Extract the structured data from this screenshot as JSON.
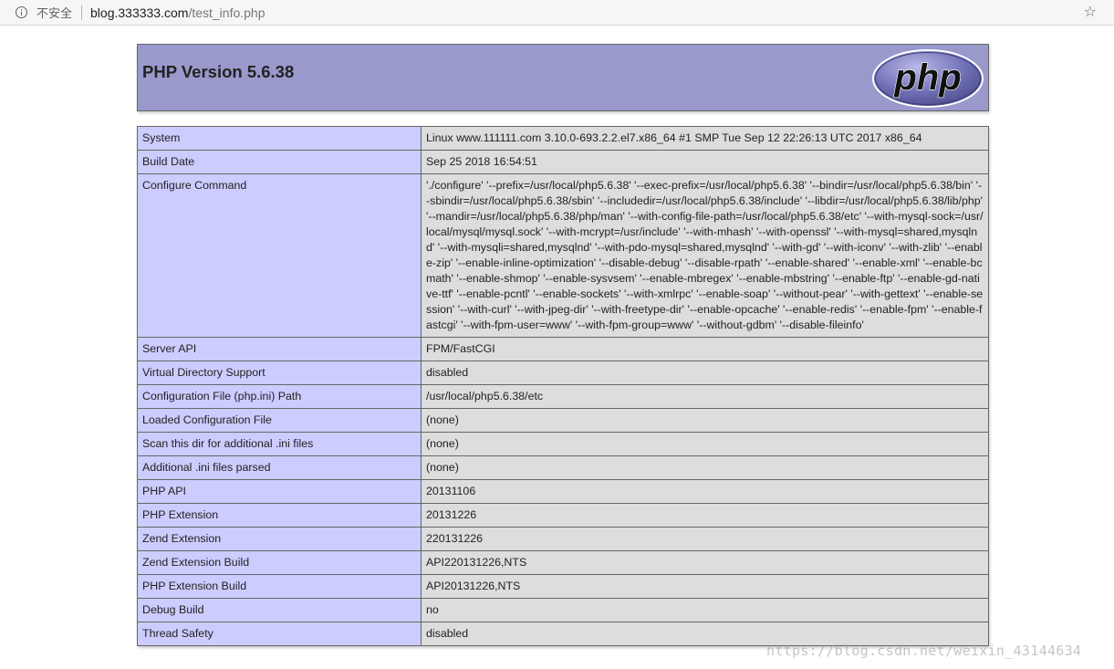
{
  "browser": {
    "security_label": "不安全",
    "url_host": "blog.333333.com",
    "url_path": "/test_info.php",
    "icons": {
      "info": "info-icon",
      "bookmark": "star-icon"
    }
  },
  "header": {
    "title": "PHP Version 5.6.38",
    "logo_text": "php",
    "colors": {
      "header_bg": "#9999cc",
      "key_bg": "#ccccff",
      "value_bg": "#dddddd"
    }
  },
  "rows": [
    {
      "key": "System",
      "value": "Linux www.111111.com 3.10.0-693.2.2.el7.x86_64 #1 SMP Tue Sep 12 22:26:13 UTC 2017 x86_64"
    },
    {
      "key": "Build Date",
      "value": "Sep 25 2018 16:54:51"
    },
    {
      "key": "Configure Command",
      "value": "'./configure' '--prefix=/usr/local/php5.6.38' '--exec-prefix=/usr/local/php5.6.38' '--bindir=/usr/local/php5.6.38/bin' '--sbindir=/usr/local/php5.6.38/sbin' '--includedir=/usr/local/php5.6.38/include' '--libdir=/usr/local/php5.6.38/lib/php' '--mandir=/usr/local/php5.6.38/php/man' '--with-config-file-path=/usr/local/php5.6.38/etc' '--with-mysql-sock=/usr/local/mysql/mysql.sock' '--with-mcrypt=/usr/include' '--with-mhash' '--with-openssl' '--with-mysql=shared,mysqlnd' '--with-mysqli=shared,mysqlnd' '--with-pdo-mysql=shared,mysqlnd' '--with-gd' '--with-iconv' '--with-zlib' '--enable-zip' '--enable-inline-optimization' '--disable-debug' '--disable-rpath' '--enable-shared' '--enable-xml' '--enable-bcmath' '--enable-shmop' '--enable-sysvsem' '--enable-mbregex' '--enable-mbstring' '--enable-ftp' '--enable-gd-native-ttf' '--enable-pcntl' '--enable-sockets' '--with-xmlrpc' '--enable-soap' '--without-pear' '--with-gettext' '--enable-session' '--with-curl' '--with-jpeg-dir' '--with-freetype-dir' '--enable-opcache' '--enable-redis' '--enable-fpm' '--enable-fastcgi' '--with-fpm-user=www' '--with-fpm-group=www' '--without-gdbm' '--disable-fileinfo'"
    },
    {
      "key": "Server API",
      "value": "FPM/FastCGI"
    },
    {
      "key": "Virtual Directory Support",
      "value": "disabled"
    },
    {
      "key": "Configuration File (php.ini) Path",
      "value": "/usr/local/php5.6.38/etc"
    },
    {
      "key": "Loaded Configuration File",
      "value": "(none)"
    },
    {
      "key": "Scan this dir for additional .ini files",
      "value": "(none)"
    },
    {
      "key": "Additional .ini files parsed",
      "value": "(none)"
    },
    {
      "key": "PHP API",
      "value": "20131106"
    },
    {
      "key": "PHP Extension",
      "value": "20131226"
    },
    {
      "key": "Zend Extension",
      "value": "220131226"
    },
    {
      "key": "Zend Extension Build",
      "value": "API220131226,NTS"
    },
    {
      "key": "PHP Extension Build",
      "value": "API20131226,NTS"
    },
    {
      "key": "Debug Build",
      "value": "no"
    },
    {
      "key": "Thread Safety",
      "value": "disabled"
    }
  ],
  "watermark": "https://blog.csdn.net/weixin_43144634"
}
